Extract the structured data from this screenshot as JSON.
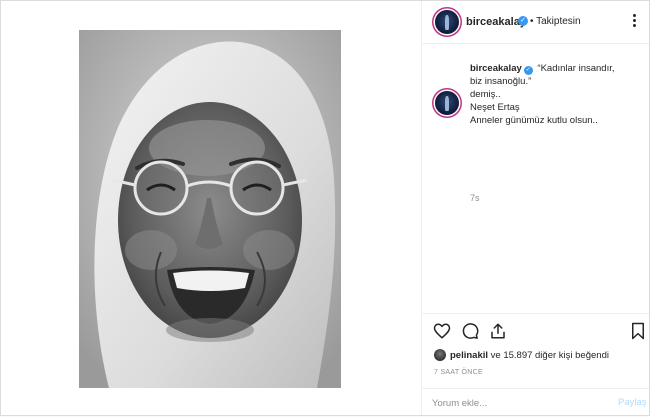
{
  "post": {
    "image_alt": "Black and white portrait of a smiling elderly woman wearing round glasses and a white headscarf"
  },
  "header": {
    "username": "birceakalay",
    "follow_state": "• Takiptesin"
  },
  "caption": {
    "username": "birceakalay",
    "lines": [
      "“Kadınlar insandır,",
      "biz insanoğlu.”",
      "demiş..",
      "Neşet Ertaş",
      "Anneler günümüz kutlu olsun.."
    ],
    "time_ago": "7s"
  },
  "likes": {
    "liker": "pelinakil",
    "rest": "ve 15.897 diğer kişi beğendi"
  },
  "post_date": "7 SAAT ÖNCE",
  "comment": {
    "placeholder": "Yorum ekle...",
    "post_label": "Paylaş"
  },
  "icons": {
    "like": "heart-icon",
    "comment": "comment-icon",
    "share": "share-icon",
    "save": "bookmark-icon",
    "more": "more-options-icon",
    "verified": "verified-badge-icon"
  },
  "colors": {
    "link_disabled": "#b3dbff",
    "verified": "#3897f0",
    "secondary_text": "#8e8e8e"
  }
}
